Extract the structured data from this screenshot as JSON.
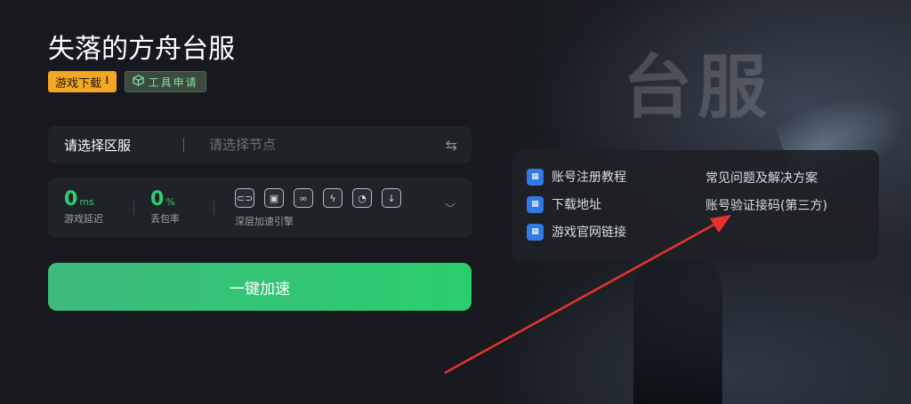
{
  "page": {
    "title": "失落的方舟台服"
  },
  "tags": {
    "download": "游戏下载",
    "tool": "工具申请"
  },
  "background": {
    "title_art": "台服"
  },
  "server": {
    "label": "请选择区服",
    "node_placeholder": "请选择节点"
  },
  "stats": {
    "latency": {
      "value": "0",
      "unit": "ms",
      "caption": "游戏延迟"
    },
    "loss": {
      "value": "0",
      "unit": "%",
      "caption": "丢包率"
    },
    "engine_caption": "深层加速引擎",
    "engine_icons": [
      "link-icon",
      "screen-icon",
      "chain-icon",
      "bolt-icon",
      "speed-icon",
      "download-icon"
    ]
  },
  "accelerate_button": "一键加速",
  "links": {
    "register_tutorial": "账号注册教程",
    "download_address": "下载地址",
    "official_site": "游戏官网链接",
    "faq": "常见问题及解决方案",
    "verify_code": "账号验证接码(第三方)"
  },
  "colors": {
    "accent_green": "#2ecc71",
    "download_tag": "#f5a623",
    "annotation_arrow": "#e8322d"
  }
}
